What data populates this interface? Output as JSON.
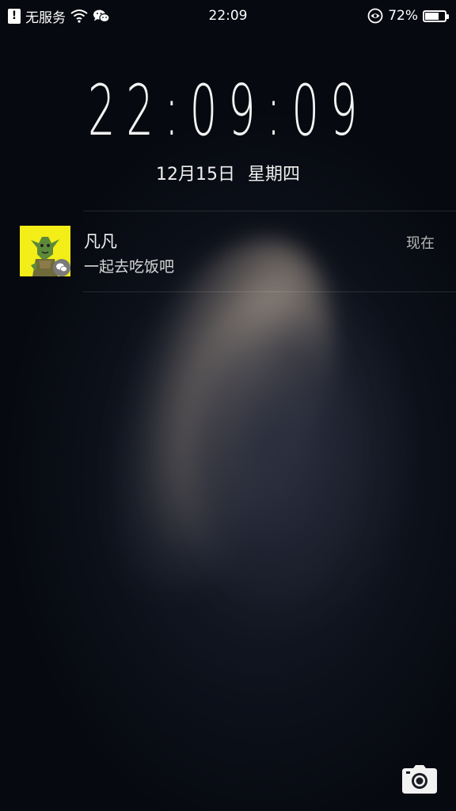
{
  "status_bar": {
    "alert_glyph": "!",
    "carrier": "无服务",
    "time": "22:09",
    "battery_percent_text": "72%",
    "battery_level": 0.72,
    "icons": [
      "alert-icon",
      "wifi-icon",
      "wechat-icon",
      "eye-protection-icon",
      "battery-icon"
    ]
  },
  "lockscreen": {
    "clock": "22:09:09",
    "date": "12月15日",
    "weekday": "星期四"
  },
  "notification": {
    "sender": "凡凡",
    "message": "一起去吃饭吧",
    "time": "现在",
    "avatar_bg": "#f3ee18",
    "app_icon": "wechat-icon"
  },
  "shortcut": {
    "icon": "camera-icon"
  }
}
